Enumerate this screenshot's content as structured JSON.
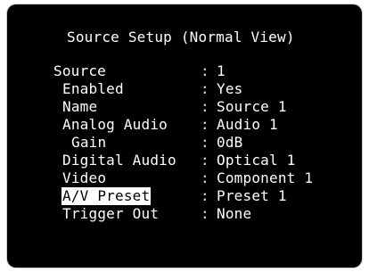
{
  "menu": {
    "title": "Source Setup (Normal View)",
    "separator": ":",
    "rows": [
      {
        "name": "source",
        "label": "Source",
        "value": "1",
        "indent": 0,
        "selected": false
      },
      {
        "name": "enabled",
        "label": "Enabled",
        "value": "Yes",
        "indent": 1,
        "selected": false
      },
      {
        "name": "name",
        "label": "Name",
        "value": "Source 1",
        "indent": 1,
        "selected": false
      },
      {
        "name": "analog-audio",
        "label": "Analog Audio",
        "value": "Audio 1",
        "indent": 1,
        "selected": false
      },
      {
        "name": "gain",
        "label": "Gain",
        "value": "0dB",
        "indent": 2,
        "selected": false
      },
      {
        "name": "digital-audio",
        "label": "Digital Audio",
        "value": "Optical 1",
        "indent": 1,
        "selected": false
      },
      {
        "name": "video",
        "label": "Video",
        "value": "Component 1",
        "indent": 1,
        "selected": false
      },
      {
        "name": "av-preset",
        "label": "A/V Preset",
        "value": "Preset 1",
        "indent": 1,
        "selected": true
      },
      {
        "name": "trigger-out",
        "label": "Trigger Out",
        "value": "None",
        "indent": 1,
        "selected": false
      }
    ]
  }
}
